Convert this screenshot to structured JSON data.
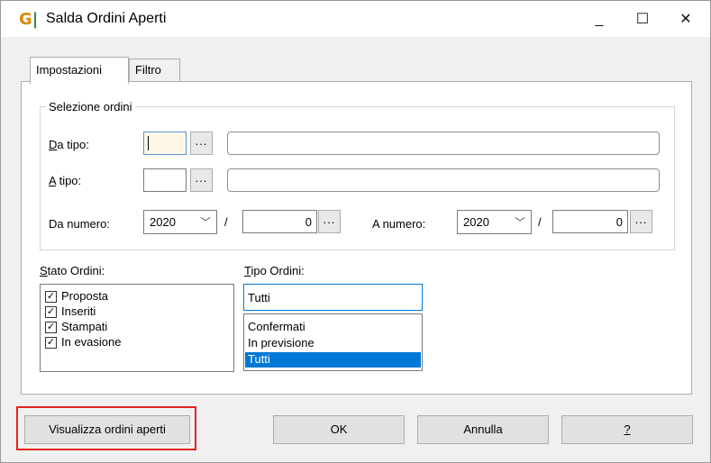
{
  "window": {
    "logo": "G",
    "title": "Salda Ordini Aperti",
    "controls": {
      "minimize": "_",
      "maximize": "☐",
      "close": "✕"
    }
  },
  "tabs": [
    {
      "label": "Impostazioni",
      "active": true
    },
    {
      "label": "Filtro",
      "active": false
    }
  ],
  "selezione": {
    "legend": "Selezione ordini",
    "da_tipo": {
      "label_u": "D",
      "label_rest": "a tipo:",
      "code": "",
      "description": "",
      "button": "..."
    },
    "a_tipo": {
      "label_u": "A",
      "label_rest": " tipo:",
      "code": "",
      "description": "",
      "button": "..."
    },
    "da_numero": {
      "label": "Da numero:",
      "year": "2020",
      "separator": "/",
      "number": "0",
      "button": "..."
    },
    "a_numero": {
      "label": "A numero:",
      "year": "2020",
      "separator": "/",
      "number": "0",
      "button": "..."
    }
  },
  "stato_ordini": {
    "label_u": "S",
    "label_rest": "tato Ordini:",
    "items": [
      {
        "label": "Proposta",
        "checked": true
      },
      {
        "label": "Inseriti",
        "checked": true
      },
      {
        "label": "Stampati",
        "checked": true
      },
      {
        "label": "In evasione",
        "checked": true
      }
    ]
  },
  "tipo_ordini": {
    "label_u": "T",
    "label_rest": "ipo Ordini:",
    "value": "Tutti",
    "options": [
      {
        "label": "Confermati",
        "selected": false
      },
      {
        "label": "In previsione",
        "selected": false
      },
      {
        "label": "Tutti",
        "selected": true
      }
    ]
  },
  "buttons": {
    "visualizza": "Visualizza ordini aperti",
    "ok": "OK",
    "annulla": "Annulla",
    "help": "?"
  },
  "colors": {
    "highlight": "#e2231a",
    "selection": "#0078d7",
    "logo": "#d98a00"
  }
}
